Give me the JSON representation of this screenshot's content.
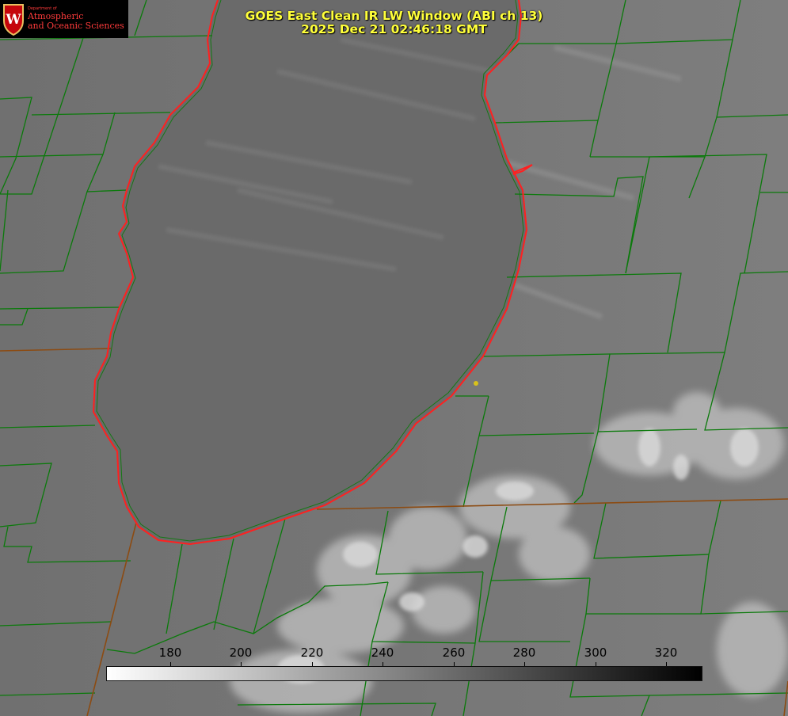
{
  "title": {
    "line1": "GOES East Clean IR LW Window (ABI ch 13)",
    "line2": "2025 Dec 21 02:46:18 GMT"
  },
  "logo": {
    "department": "Department of",
    "line1": "Atmospheric",
    "line2": "and Oceanic Sciences",
    "seal_icon": "uw-crest-icon"
  },
  "colorbar": {
    "ticks": [
      "180",
      "200",
      "220",
      "240",
      "260",
      "280",
      "300",
      "320"
    ],
    "gradient_start": "#ffffff",
    "gradient_end": "#000000"
  },
  "map": {
    "lake_color": "#6d6d6d",
    "land_color": "#777777",
    "cloud_color": "#c4c4c4",
    "boundary_color": "#0a7a0a",
    "shoreline_color": "#ff2222",
    "state_border_color": "#8a4a10",
    "marker_color": "#d8c21a"
  }
}
